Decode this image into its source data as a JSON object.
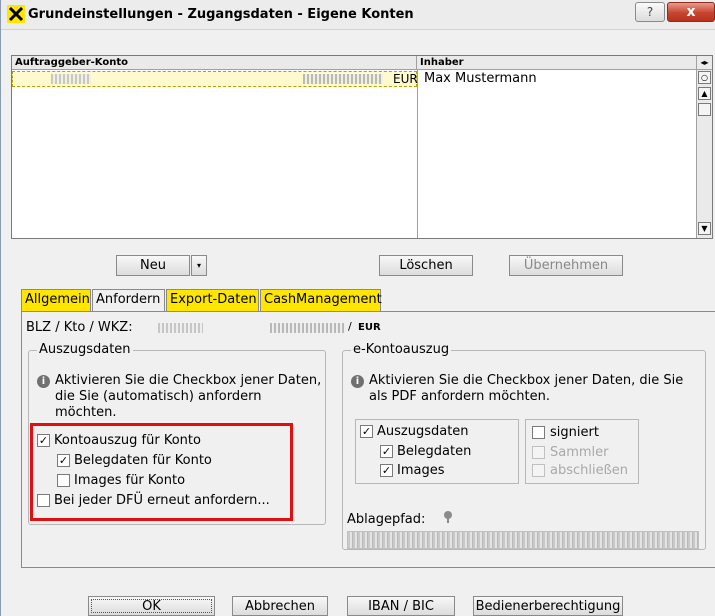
{
  "window": {
    "title": "Grundeinstellungen - Zugangsdaten - Eigene Konten",
    "help_label": "?",
    "close_label": "x"
  },
  "accounts_table": {
    "columns": [
      "Auftraggeber-Konto",
      "Inhaber"
    ],
    "rows": [
      {
        "currency": "EUR",
        "owner": "Max Mustermann"
      }
    ]
  },
  "actions": {
    "new": "Neu",
    "delete": "Löschen",
    "apply": "Übernehmen"
  },
  "tabs": [
    {
      "label": "Allgemein",
      "active": false
    },
    {
      "label": "Anfordern",
      "active": true
    },
    {
      "label": "Export-Daten",
      "active": false
    },
    {
      "label": "CashManagement",
      "active": false
    }
  ],
  "account_info": {
    "label": "BLZ / Kto / WKZ:",
    "separator": "/",
    "currency": "EUR"
  },
  "statements": {
    "title": "Auszugsdaten",
    "info": "Aktivieren Sie die Checkbox jener Daten, die Sie (automatisch) anfordern möchten.",
    "options": [
      {
        "label": "Kontoauszug für Konto",
        "checked": true
      },
      {
        "label": "Belegdaten für Konto",
        "checked": true
      },
      {
        "label": "Images für Konto",
        "checked": false
      },
      {
        "label": "Bei jeder DFÜ erneut anfordern...",
        "checked": false
      }
    ]
  },
  "e_statement": {
    "title": "e-Kontoauszug",
    "info": "Aktivieren Sie die Checkbox jener Daten, die Sie als PDF anfordern möchten.",
    "options": [
      {
        "label": "Auszugsdaten",
        "checked": true
      },
      {
        "label": "Belegdaten",
        "checked": true
      },
      {
        "label": "Images",
        "checked": true
      }
    ],
    "options_right": [
      {
        "label": "signiert",
        "checked": false,
        "enabled": true
      },
      {
        "label": "Sammler",
        "checked": false,
        "enabled": false
      },
      {
        "label": "abschließen",
        "checked": false,
        "enabled": false
      }
    ],
    "path_label": "Ablagepfad:"
  },
  "footer": {
    "ok": "OK",
    "cancel": "Abbrechen",
    "iban": "IBAN / BIC",
    "operator": "Bedienerberechtigung"
  },
  "icons": {
    "app": "raiffeisen-cross-icon",
    "info": "info-icon",
    "path": "pin-icon"
  },
  "colors": {
    "tab_highlight": "#ffe600",
    "selected_row": "#fffacd",
    "highlight_frame": "#e01010",
    "close_button": "#c8452f"
  }
}
